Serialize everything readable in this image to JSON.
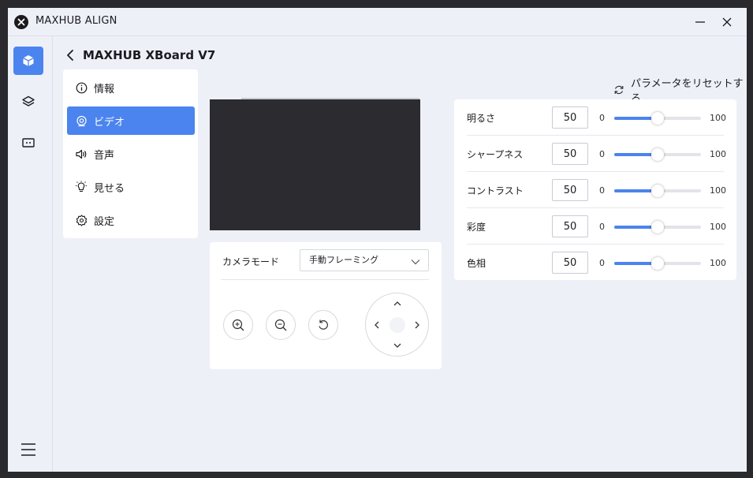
{
  "app": {
    "title": "MAXHUB ALIGN",
    "page_title": "MAXHUB XBoard V7"
  },
  "menu": {
    "items": [
      {
        "label": "情報",
        "icon": "info-icon"
      },
      {
        "label": "ビデオ",
        "icon": "camera-icon",
        "active": true
      },
      {
        "label": "音声",
        "icon": "speaker-icon"
      },
      {
        "label": "見せる",
        "icon": "lightbulb-icon"
      },
      {
        "label": "設定",
        "icon": "gear-icon"
      }
    ]
  },
  "camera": {
    "mode_label": "カメラモード",
    "mode_value": "手動フレーミング"
  },
  "reset_label": "パラメータをリセットする",
  "params": [
    {
      "name": "明るさ",
      "value": "50",
      "min": "0",
      "max": "100",
      "level": 0.5
    },
    {
      "name": "シャープネス",
      "value": "50",
      "min": "0",
      "max": "100",
      "level": 0.5
    },
    {
      "name": "コントラスト",
      "value": "50",
      "min": "0",
      "max": "100",
      "level": 0.5
    },
    {
      "name": "彩度",
      "value": "50",
      "min": "0",
      "max": "100",
      "level": 0.5
    },
    {
      "name": "色相",
      "value": "50",
      "min": "0",
      "max": "100",
      "level": 0.5
    }
  ],
  "colors": {
    "accent": "#4b84ee",
    "background": "#eef0f8",
    "video": "#2c2b30"
  }
}
